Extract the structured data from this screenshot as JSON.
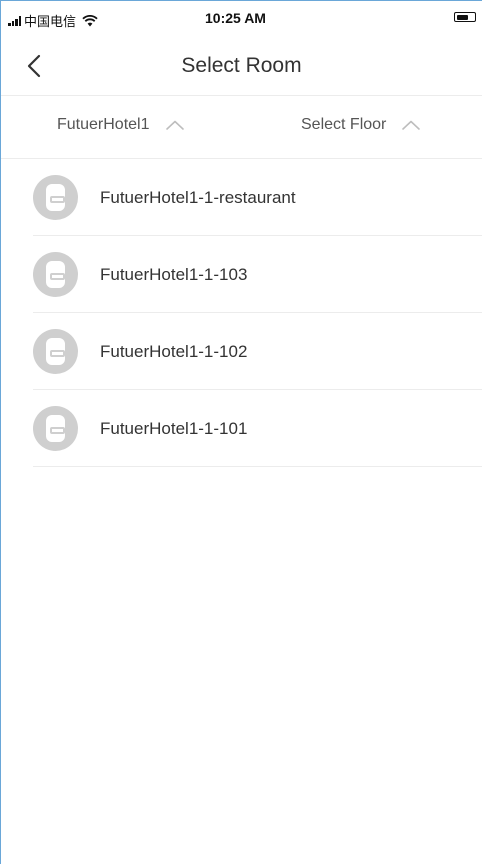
{
  "status_bar": {
    "carrier": "中国电信",
    "time": "10:25 AM"
  },
  "nav": {
    "title": "Select Room"
  },
  "filters": {
    "hotel": "FutuerHotel1",
    "floor": "Select Floor"
  },
  "rooms": [
    {
      "name": "FutuerHotel1-1-restaurant"
    },
    {
      "name": "FutuerHotel1-1-103"
    },
    {
      "name": "FutuerHotel1-1-102"
    },
    {
      "name": "FutuerHotel1-1-101"
    }
  ],
  "colors": {
    "avatar_bg": "#cfcfcf",
    "divider": "#ececec",
    "text": "#333333"
  }
}
